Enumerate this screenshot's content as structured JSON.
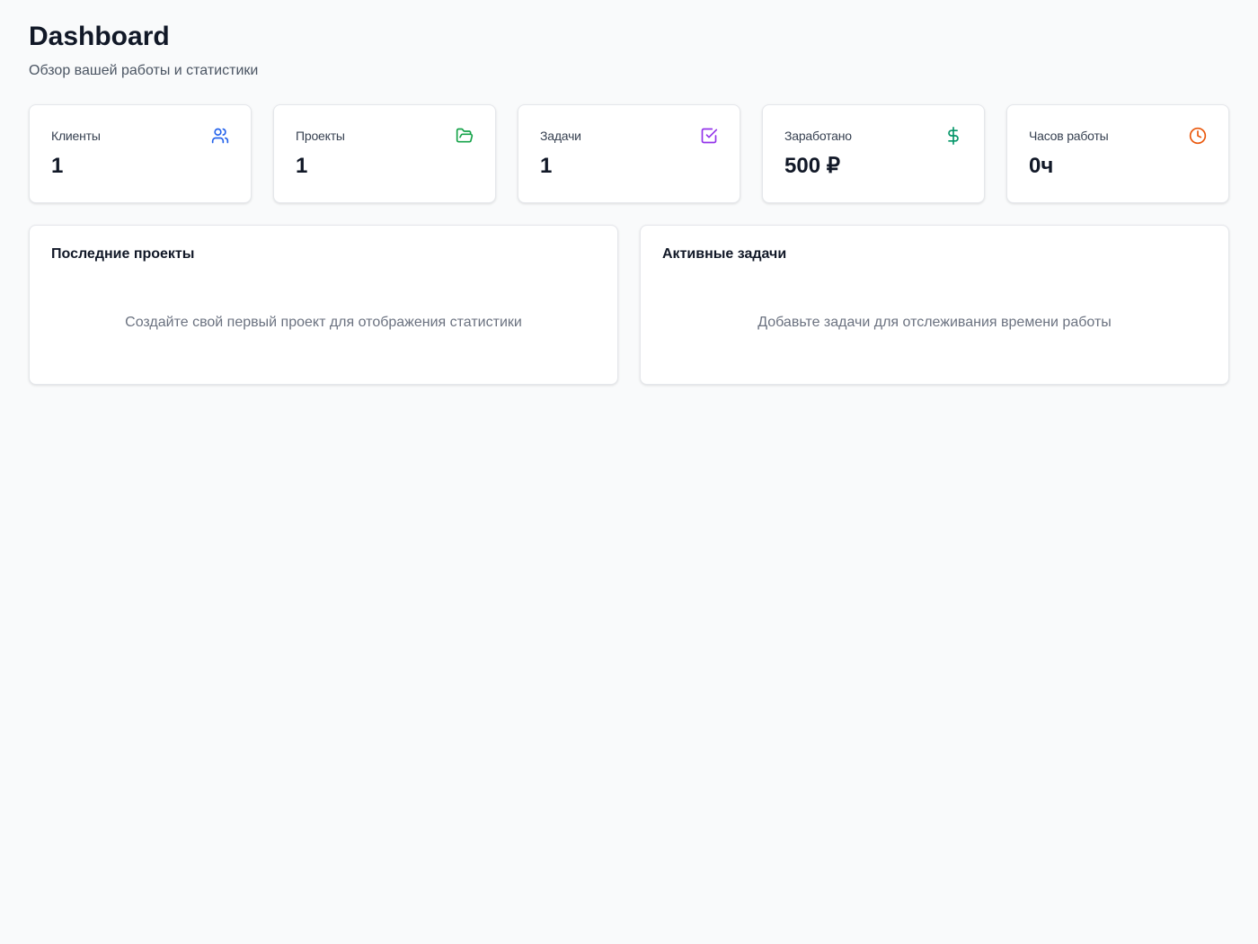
{
  "header": {
    "title": "Dashboard",
    "subtitle": "Обзор вашей работы и статистики"
  },
  "stats": [
    {
      "label": "Клиенты",
      "value": "1",
      "icon": "users-icon",
      "color": "#2563eb"
    },
    {
      "label": "Проекты",
      "value": "1",
      "icon": "folder-open-icon",
      "color": "#16a34a"
    },
    {
      "label": "Задачи",
      "value": "1",
      "icon": "check-square-icon",
      "color": "#9333ea"
    },
    {
      "label": "Заработано",
      "value": "500 ₽",
      "icon": "dollar-icon",
      "color": "#059669"
    },
    {
      "label": "Часов работы",
      "value": "0ч",
      "icon": "clock-icon",
      "color": "#ea580c"
    }
  ],
  "panels": {
    "recent_projects": {
      "title": "Последние проекты",
      "empty_text": "Создайте свой первый проект для отображения статистики"
    },
    "active_tasks": {
      "title": "Активные задачи",
      "empty_text": "Добавьте задачи для отслеживания времени работы"
    }
  }
}
